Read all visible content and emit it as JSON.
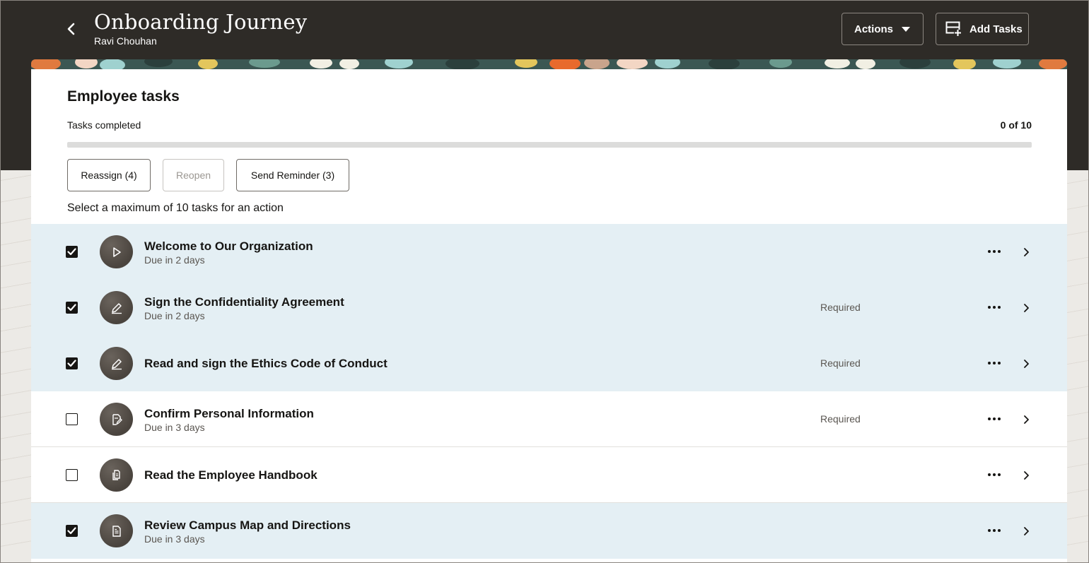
{
  "header": {
    "title": "Onboarding Journey",
    "subtitle": "Ravi Chouhan",
    "actions_label": "Actions",
    "add_tasks_label": "Add Tasks"
  },
  "card": {
    "title": "Employee tasks",
    "tasks_completed_label": "Tasks completed",
    "tasks_completed_count": "0 of 10",
    "progress_fraction": 0,
    "buttons": {
      "reassign": "Reassign (4)",
      "reopen": "Reopen",
      "send_reminder": "Send Reminder (3)"
    },
    "hint": "Select a maximum of 10 tasks for an action"
  },
  "tasks": [
    {
      "name": "Welcome to Our Organization",
      "due": "Due in 2 days",
      "required": "",
      "checked": true,
      "icon": "play-icon"
    },
    {
      "name": "Sign the Confidentiality Agreement",
      "due": "Due in 2 days",
      "required": "Required",
      "checked": true,
      "icon": "pencil-icon"
    },
    {
      "name": "Read and sign the Ethics Code of Conduct",
      "due": "",
      "required": "Required",
      "checked": true,
      "icon": "pencil-icon"
    },
    {
      "name": "Confirm Personal Information",
      "due": "Due in 3 days",
      "required": "Required",
      "checked": false,
      "icon": "edit-document-icon"
    },
    {
      "name": "Read the Employee Handbook",
      "due": "",
      "required": "",
      "checked": false,
      "icon": "documents-icon"
    },
    {
      "name": "Review Campus Map and Directions",
      "due": "Due in 3 days",
      "required": "",
      "checked": true,
      "icon": "document-icon"
    }
  ],
  "colors": {
    "header_bg": "#2e2b27",
    "selected_row_bg": "#e4eff4",
    "progress_track": "#dcdcdb"
  }
}
